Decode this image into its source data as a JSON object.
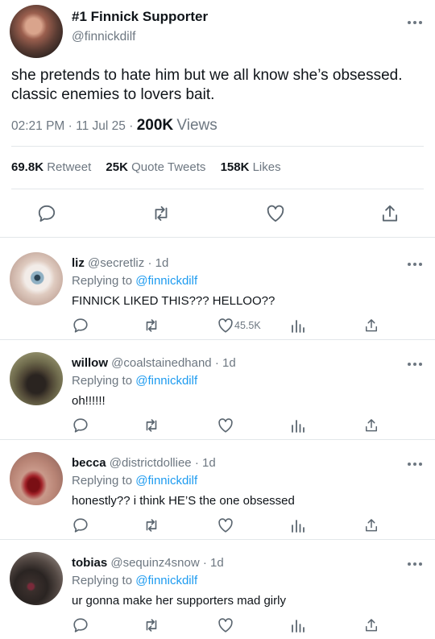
{
  "main_tweet": {
    "display_name": "#1 Finnick Supporter",
    "handle": "@finnickdilf",
    "text": "she pretends to hate him but we all know she’s obsessed. classic enemies to lovers bait.",
    "time": "02:21 PM",
    "date": "11 Jul 25",
    "views_count": "200K",
    "views_label": "Views",
    "retweets_count": "69.8K",
    "retweets_label": "Retweet",
    "quotes_count": "25K",
    "quotes_label": "Quote Tweets",
    "likes_count": "158K",
    "likes_label": "Likes"
  },
  "replies": [
    {
      "name": "liz",
      "handle": "@secretliz",
      "age": "1d",
      "replying_label": "Replying to",
      "replying_to": "@finnickdilf",
      "text": "FINNICK LIKED THIS??? HELLOO??",
      "like_count": "45.5K"
    },
    {
      "name": "willow",
      "handle": "@coalstainedhand",
      "age": "1d",
      "replying_label": "Replying to",
      "replying_to": "@finnickdilf",
      "text": "oh!!!!!!",
      "like_count": ""
    },
    {
      "name": "becca",
      "handle": "@districtdolliee",
      "age": "1d",
      "replying_label": "Replying to",
      "replying_to": "@finnickdilf",
      "text": "honestly?? i think HE’S the one obsessed",
      "like_count": ""
    },
    {
      "name": "tobias",
      "handle": "@sequinz4snow",
      "age": "1d",
      "replying_label": "Replying to",
      "replying_to": "@finnickdilf",
      "text": "ur gonna make her supporters mad girly",
      "like_count": ""
    }
  ],
  "icons": {
    "more": "more-dots-icon",
    "reply": "speech-bubble-icon",
    "retweet": "retweet-icon",
    "like": "heart-icon",
    "views": "bar-chart-icon",
    "share": "share-icon"
  },
  "colors": {
    "link": "#1d9bf0",
    "secondary_text": "#6d7781",
    "divider": "#e3e7ea"
  }
}
